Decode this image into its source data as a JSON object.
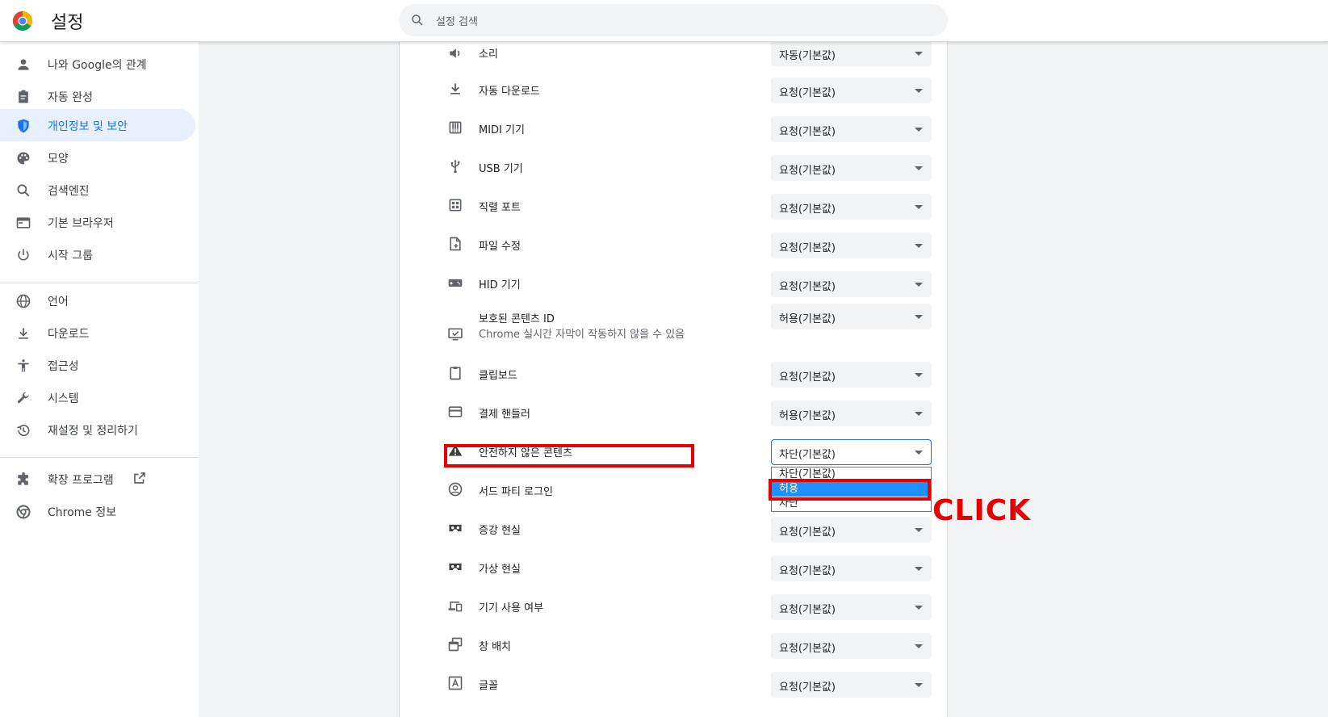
{
  "header": {
    "title": "설정",
    "search_placeholder": "설정 검색"
  },
  "sidebar": {
    "items": [
      {
        "label": "나와 Google의 관계",
        "icon": "person-icon"
      },
      {
        "label": "자동 완성",
        "icon": "clipboard-icon"
      },
      {
        "label": "개인정보 및 보안",
        "icon": "shield-icon",
        "active": true
      },
      {
        "label": "모양",
        "icon": "palette-icon"
      },
      {
        "label": "검색엔진",
        "icon": "search-icon"
      },
      {
        "label": "기본 브라우저",
        "icon": "browser-icon"
      },
      {
        "label": "시작 그룹",
        "icon": "power-icon"
      },
      {
        "label": "언어",
        "icon": "globe-icon"
      },
      {
        "label": "다운로드",
        "icon": "download-icon"
      },
      {
        "label": "접근성",
        "icon": "accessibility-icon"
      },
      {
        "label": "시스템",
        "icon": "wrench-icon"
      },
      {
        "label": "재설정 및 정리하기",
        "icon": "history-icon"
      },
      {
        "label": "확장 프로그램",
        "icon": "puzzle-icon"
      },
      {
        "label": "Chrome 정보",
        "icon": "chrome-icon"
      }
    ]
  },
  "settings": {
    "rows": [
      {
        "label": "소리",
        "value": "자동(기본값)",
        "icon": "speaker-icon"
      },
      {
        "label": "자동 다운로드",
        "value": "요청(기본값)",
        "icon": "download-icon"
      },
      {
        "label": "MIDI 기기",
        "value": "요청(기본값)",
        "icon": "piano-icon"
      },
      {
        "label": "USB 기기",
        "value": "요청(기본값)",
        "icon": "usb-icon"
      },
      {
        "label": "직렬 포트",
        "value": "요청(기본값)",
        "icon": "serial-port-icon"
      },
      {
        "label": "파일 수정",
        "value": "요청(기본값)",
        "icon": "file-edit-icon"
      },
      {
        "label": "HID 기기",
        "value": "요청(기본값)",
        "icon": "gamepad-icon"
      },
      {
        "label": "보호된 콘텐츠 ID",
        "sublabel": "Chrome 실시간 자막이 작동하지 않을 수 있음",
        "value": "허용(기본값)",
        "icon": "protected-content-icon"
      },
      {
        "label": "클립보드",
        "value": "요청(기본값)",
        "icon": "clipboard-icon"
      },
      {
        "label": "결제 핸들러",
        "value": "허용(기본값)",
        "icon": "credit-card-icon"
      },
      {
        "label": "안전하지 않은 콘텐츠",
        "value": "차단(기본값)",
        "icon": "warning-icon"
      },
      {
        "label": "서드 파티 로그인",
        "value": "",
        "icon": "account-circle-icon"
      },
      {
        "label": "증강 현실",
        "value": "요청(기본값)",
        "icon": "vr-goggles-icon"
      },
      {
        "label": "가상 현실",
        "value": "요청(기본값)",
        "icon": "vr-goggles-icon"
      },
      {
        "label": "기기 사용 여부",
        "value": "요청(기본값)",
        "icon": "devices-icon"
      },
      {
        "label": "창 배치",
        "value": "요청(기본값)",
        "icon": "window-placement-icon"
      },
      {
        "label": "글꼴",
        "value": "요청(기본값)",
        "icon": "font-icon"
      }
    ]
  },
  "dropdown": {
    "options": [
      "차단(기본값)",
      "허용",
      "차단"
    ],
    "selected_index": 1
  },
  "annotation": {
    "click_label": "CLICK",
    "color": "#e60000"
  },
  "colors": {
    "accent": "#1a73e8",
    "active_bg": "#e8f0fe",
    "select_bg": "#f1f3f4",
    "option_highlight": "#1e90ff"
  }
}
